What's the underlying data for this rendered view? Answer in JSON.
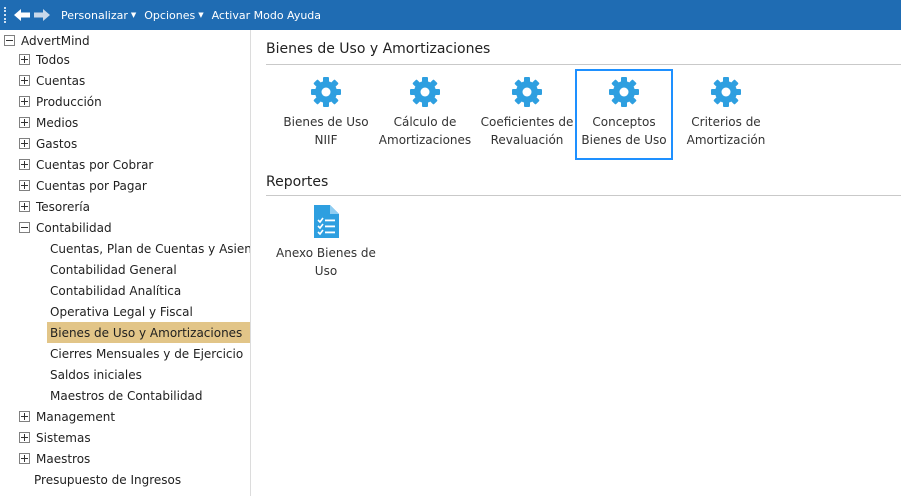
{
  "toolbar": {
    "back_icon": "arrow-left-icon",
    "forward_icon": "arrow-right-icon",
    "menus": [
      "Personalizar",
      "Opciones"
    ],
    "help_label": "Activar Modo Ayuda"
  },
  "sidebar": {
    "root": "AdvertMind",
    "items": [
      {
        "label": "Todos"
      },
      {
        "label": "Cuentas"
      },
      {
        "label": "Producción"
      },
      {
        "label": "Medios"
      },
      {
        "label": "Gastos"
      },
      {
        "label": "Cuentas por Cobrar"
      },
      {
        "label": "Cuentas por Pagar"
      },
      {
        "label": "Tesorería"
      },
      {
        "label": "Contabilidad"
      }
    ],
    "contabilidad_children": [
      "Cuentas, Plan de Cuentas y Asient",
      "Contabilidad General",
      "Contabilidad Analítica",
      "Operativa Legal y Fiscal",
      "Bienes de Uso y Amortizaciones",
      "Cierres Mensuales y de Ejercicio",
      "Saldos iniciales",
      "Maestros de Contabilidad"
    ],
    "after_items": [
      {
        "label": "Management"
      },
      {
        "label": "Sistemas"
      },
      {
        "label": "Maestros"
      }
    ],
    "leaf_item": "Presupuesto de Ingresos",
    "selected": "Bienes de Uso y Amortizaciones"
  },
  "main": {
    "section_title": "Bienes de Uso y Amortizaciones",
    "tiles": [
      {
        "line1": "Bienes de Uso",
        "line2": "NIIF",
        "icon": "gear-icon"
      },
      {
        "line1": "Cálculo de",
        "line2": "Amortizaciones",
        "icon": "gear-icon"
      },
      {
        "line1": "Coeficientes de",
        "line2": "Revaluación",
        "icon": "gear-icon"
      },
      {
        "line1": "Conceptos",
        "line2": "Bienes de Uso",
        "icon": "gear-icon"
      },
      {
        "line1": "Criterios de",
        "line2": "Amortización",
        "icon": "gear-icon"
      }
    ],
    "reports_title": "Reportes",
    "reports": [
      {
        "line1": "Anexo Bienes de",
        "line2": "Uso",
        "icon": "report-document-icon"
      }
    ]
  },
  "colors": {
    "topbar": "#1f6cb3",
    "accent_icon": "#2e9fe0",
    "selected_row": "#e2c588",
    "focus_border": "#1e90ff"
  }
}
